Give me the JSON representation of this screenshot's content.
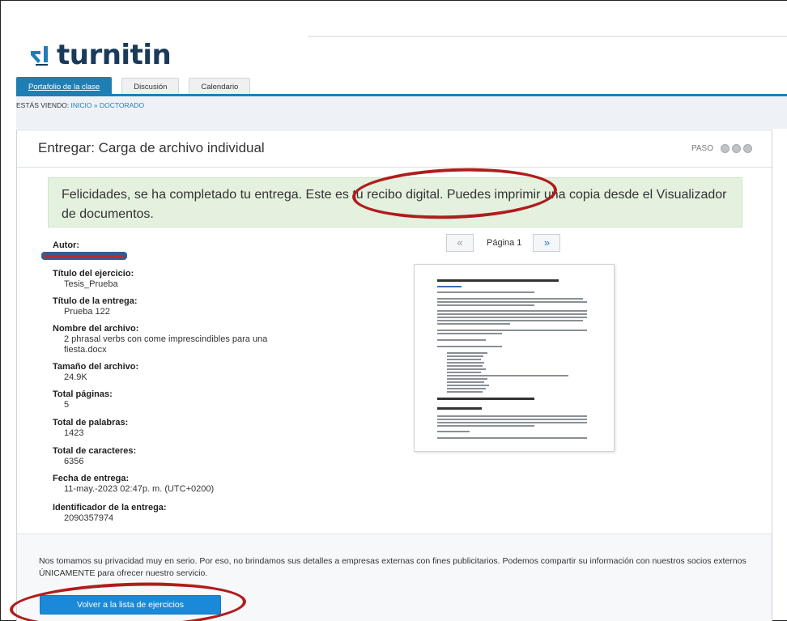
{
  "app": {
    "logo_text": "turnitin"
  },
  "tabs": [
    {
      "label": "Portafolio de la clase",
      "active": true
    },
    {
      "label": "Discusión",
      "active": false
    },
    {
      "label": "Calendario",
      "active": false
    }
  ],
  "breadcrumb": {
    "prefix": "ESTÁS VIENDO: ",
    "home": "INICIO",
    "separator": " » ",
    "current": "DOCTORADO"
  },
  "card": {
    "title": "Entregar: Carga de archivo individual",
    "step_label": "PASO",
    "step_count": 3
  },
  "success_message": "Felicidades, se ha completado tu entrega. Este es tu recibo digital. Puedes imprimir una copia desde el Visualizador de documentos.",
  "details": {
    "author_label": "Autor:",
    "assignment_label": "Título del ejercicio:",
    "assignment_value": "Tesis_Prueba",
    "submission_title_label": "Título de la entrega:",
    "submission_title_value": "Prueba 122",
    "filename_label": "Nombre del archivo:",
    "filename_value": "2 phrasal verbs con come imprescindibles para una fiesta.docx",
    "filesize_label": "Tamaño del archivo:",
    "filesize_value": "24.9K",
    "pages_label": "Total páginas:",
    "pages_value": "5",
    "words_label": "Total de palabras:",
    "words_value": "1423",
    "chars_label": "Total de caracteres:",
    "chars_value": "6356",
    "date_label": "Fecha de entrega:",
    "date_value": "11-may.-2023 02:47p. m. (UTC+0200)",
    "id_label": "Identificador de la entrega:",
    "id_value": "2090357974"
  },
  "pager": {
    "prev": "«",
    "label": "Página 1",
    "next": "»"
  },
  "footer": {
    "privacy_text": "Nos tomamos su privacidad muy en serio. Por eso, no brindamos sus detalles a empresas externas con fines publicitarios. Podemos compartir su información con nuestros socios externos ÚNICAMENTE para ofrecer nuestro servicio.",
    "back_button": "Volver a la lista de ejercicios"
  },
  "colors": {
    "brand_blue": "#1f7fb5",
    "button_blue": "#1a8ad8",
    "success_bg": "#e4f1df",
    "annotation_red": "#b01c1c"
  }
}
